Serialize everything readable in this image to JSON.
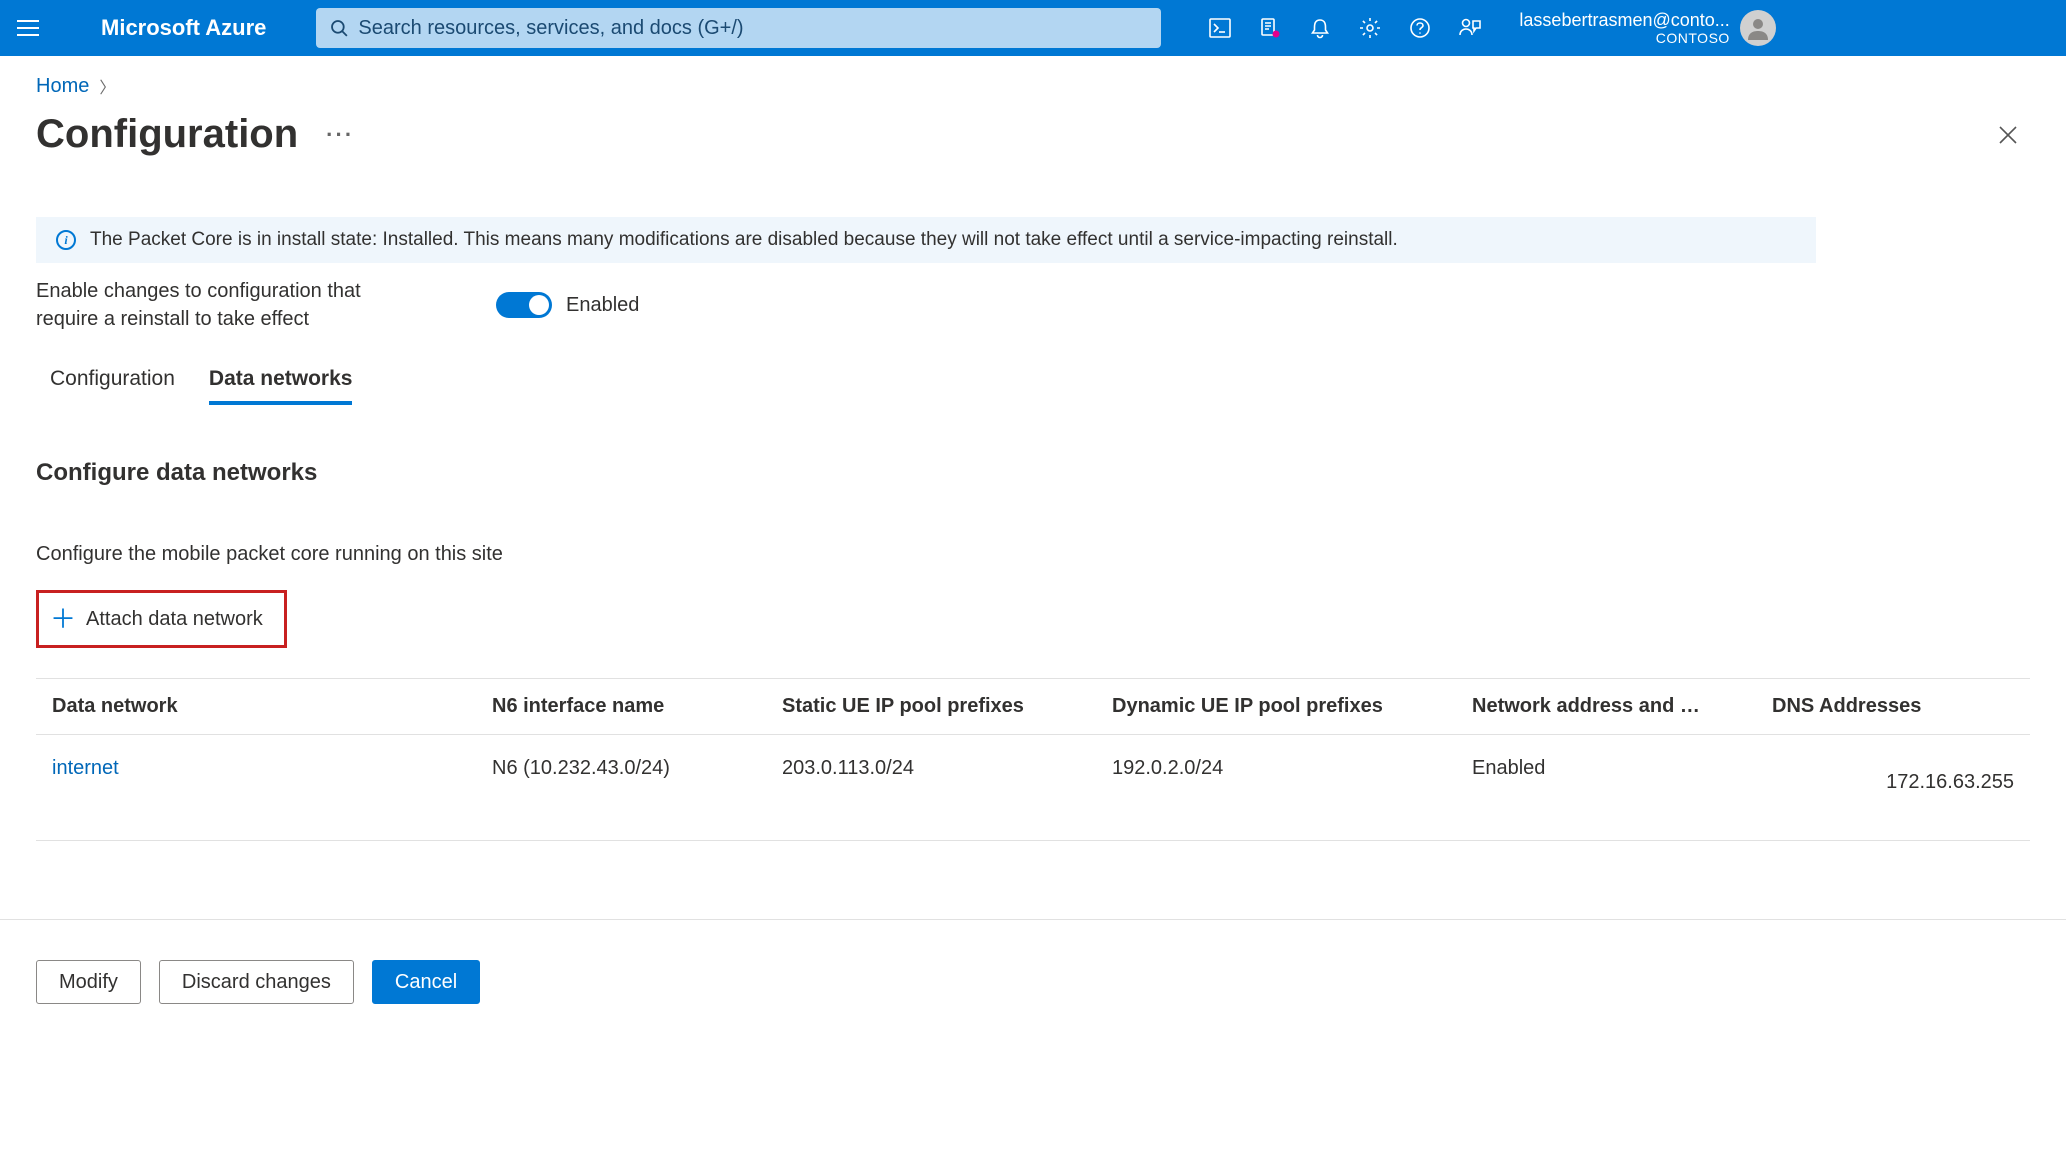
{
  "header": {
    "brand": "Microsoft Azure",
    "search_placeholder": "Search resources, services, and docs (G+/)",
    "user_email": "lassebertrasmen@conto...",
    "tenant": "CONTOSO"
  },
  "breadcrumb": {
    "home": "Home"
  },
  "page": {
    "title": "Configuration"
  },
  "banner": {
    "text": "The Packet Core is in install state: Installed. This means many modifications are disabled because they will not take effect until a service-impacting reinstall."
  },
  "enable_changes": {
    "label": "Enable changes to configuration that require a reinstall to take effect",
    "status": "Enabled"
  },
  "tabs": {
    "config": "Configuration",
    "data_networks": "Data networks"
  },
  "section": {
    "title": "Configure data networks",
    "desc": "Configure the mobile packet core running on this site"
  },
  "attach_button": "Attach data network",
  "table": {
    "headers": {
      "data_network": "Data network",
      "n6": "N6 interface name",
      "static_ue": "Static UE IP pool prefixes",
      "dynamic_ue": "Dynamic UE IP pool prefixes",
      "napt": "Network address and …",
      "dns": "DNS Addresses"
    },
    "rows": [
      {
        "data_network": "internet",
        "n6": "N6 (10.232.43.0/24)",
        "static_ue": "203.0.113.0/24",
        "dynamic_ue": "192.0.2.0/24",
        "napt": "Enabled",
        "dns": "172.16.63.255"
      }
    ]
  },
  "footer": {
    "modify": "Modify",
    "discard": "Discard changes",
    "cancel": "Cancel"
  },
  "colors": {
    "azure_blue": "#0078d4",
    "link_blue": "#0067b8",
    "highlight_red": "#c82020"
  }
}
